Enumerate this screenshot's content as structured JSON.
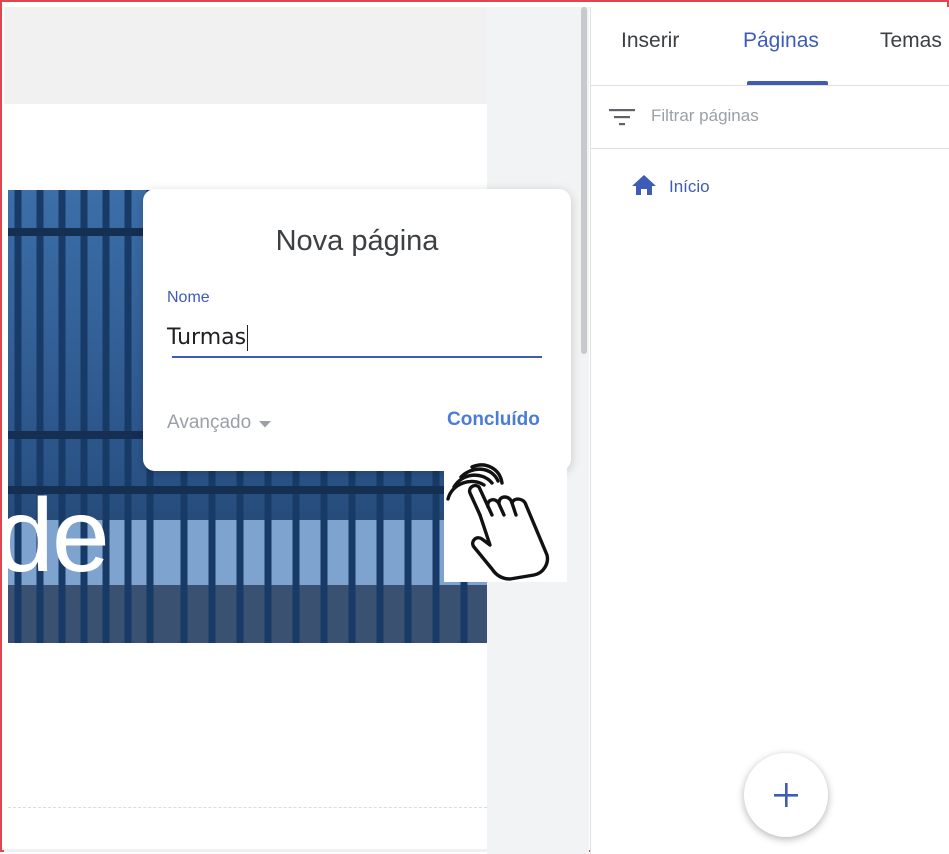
{
  "editor": {
    "banner_text": "de"
  },
  "side_panel": {
    "tabs": [
      {
        "label": "Inserir",
        "active": false
      },
      {
        "label": "Páginas",
        "active": true
      },
      {
        "label": "Temas",
        "active": false
      }
    ],
    "filter": {
      "placeholder": "Filtrar páginas",
      "icon": "filter-list-icon"
    },
    "pages": [
      {
        "label": "Início",
        "icon": "home-icon"
      }
    ],
    "fab": {
      "icon": "plus-icon"
    }
  },
  "dialog": {
    "title": "Nova página",
    "name_label": "Nome",
    "name_value": "Turmas",
    "advanced_label": "Avançado",
    "done_label": "Concluído"
  },
  "colors": {
    "accent": "#3e5bb8",
    "link": "#4a7dd6",
    "muted": "#9aa0a6"
  }
}
